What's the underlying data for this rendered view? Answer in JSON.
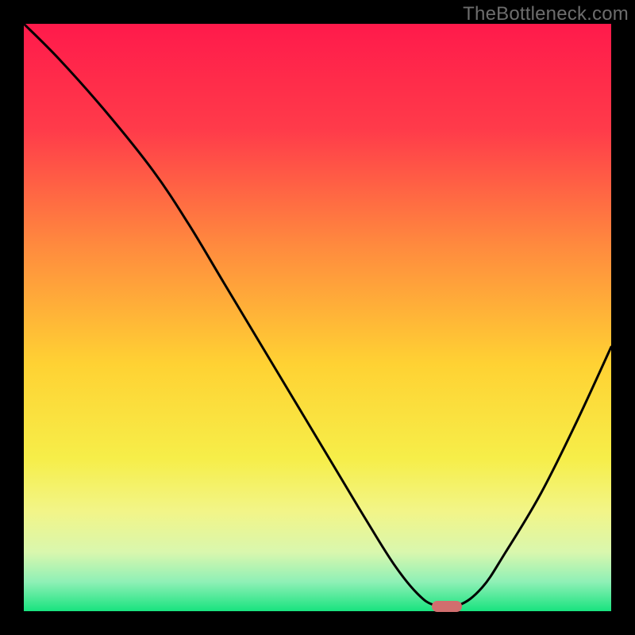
{
  "watermark": "TheBottleneck.com",
  "chart_data": {
    "type": "line",
    "title": "",
    "xlabel": "",
    "ylabel": "",
    "xlim": [
      0,
      100
    ],
    "ylim": [
      0,
      100
    ],
    "background_gradient": {
      "stops": [
        {
          "pct": 0,
          "color": "#ff1a4b"
        },
        {
          "pct": 18,
          "color": "#ff3b4a"
        },
        {
          "pct": 38,
          "color": "#ff8b3e"
        },
        {
          "pct": 58,
          "color": "#ffd233"
        },
        {
          "pct": 74,
          "color": "#f6ee49"
        },
        {
          "pct": 83,
          "color": "#f2f588"
        },
        {
          "pct": 90,
          "color": "#d9f7ae"
        },
        {
          "pct": 95,
          "color": "#8ff0b6"
        },
        {
          "pct": 100,
          "color": "#18e37f"
        }
      ]
    },
    "series": [
      {
        "name": "bottleneck-curve",
        "color": "#000000",
        "x": [
          0,
          6,
          14,
          22,
          28,
          34,
          40,
          46,
          52,
          58,
          63,
          67,
          70,
          74,
          78,
          82,
          88,
          94,
          100
        ],
        "y": [
          100,
          94,
          85,
          75,
          66,
          56,
          46,
          36,
          26,
          16,
          8,
          3,
          1,
          1,
          4,
          10,
          20,
          32,
          45
        ]
      }
    ],
    "marker": {
      "name": "optimal-marker",
      "x": 72,
      "y": 0.8,
      "color": "#d16e6e"
    }
  }
}
